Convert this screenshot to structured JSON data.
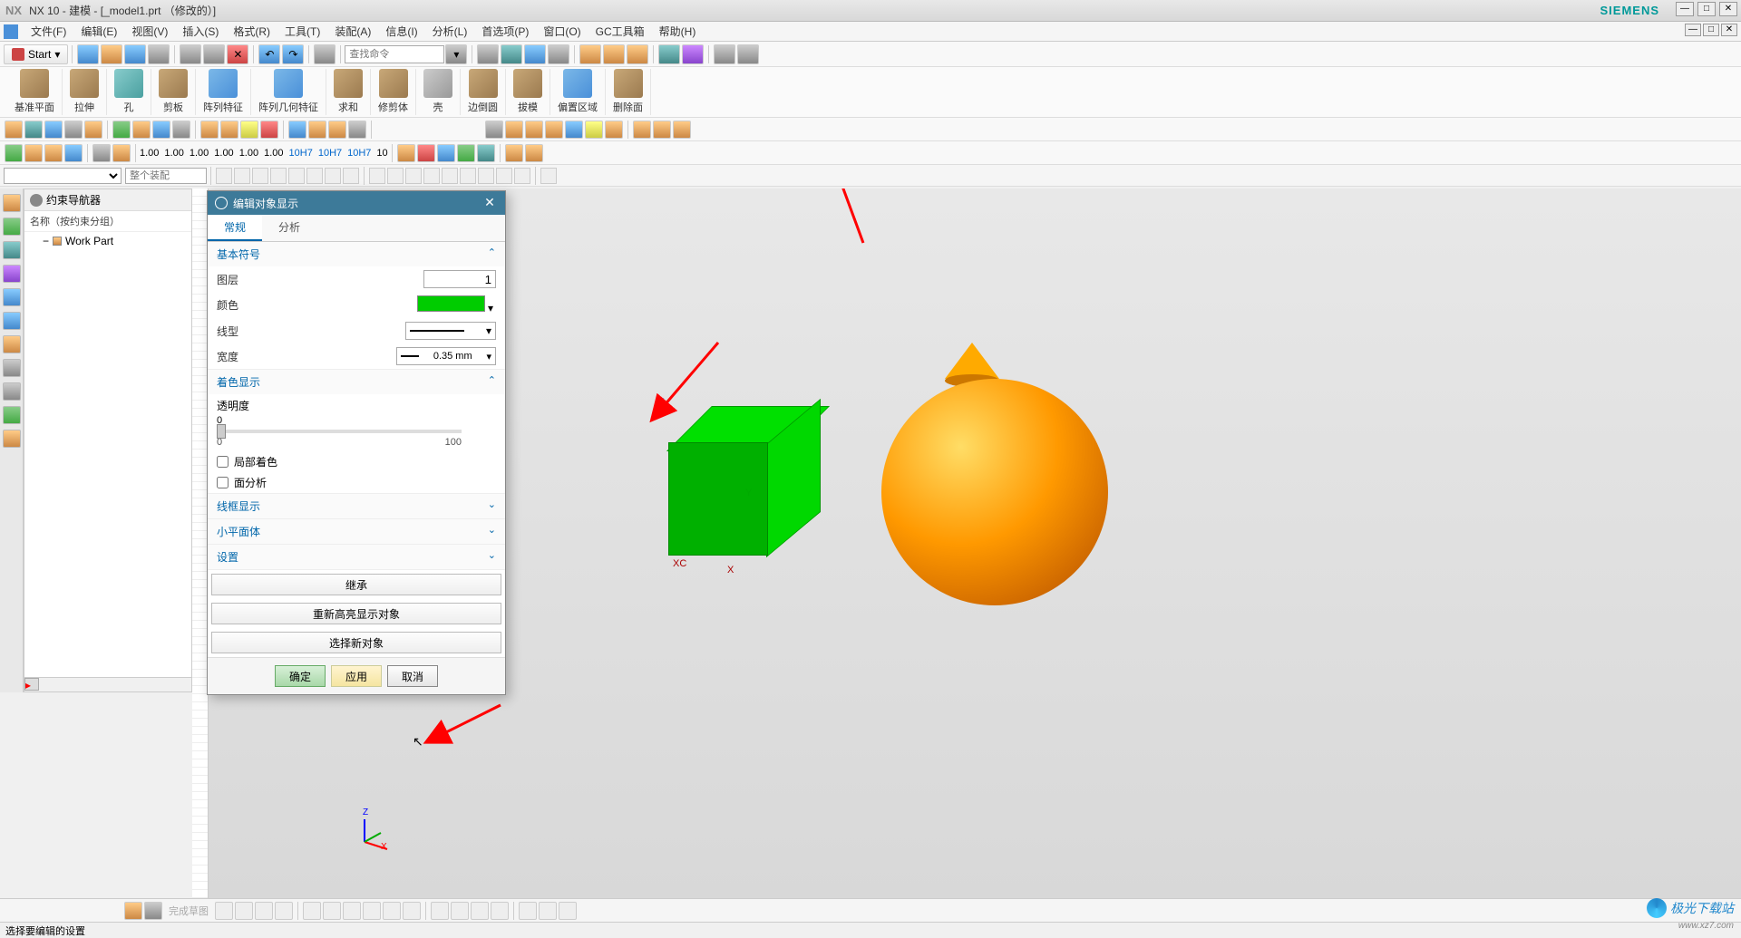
{
  "title": {
    "app": "NX",
    "version": "NX 10 - 建模 - [_model1.prt （修改的）]",
    "brand": "SIEMENS"
  },
  "menu": {
    "items": [
      "文件(F)",
      "编辑(E)",
      "视图(V)",
      "插入(S)",
      "格式(R)",
      "工具(T)",
      "装配(A)",
      "信息(I)",
      "分析(L)",
      "首选项(P)",
      "窗口(O)",
      "GC工具箱",
      "帮助(H)"
    ]
  },
  "toolbar_main": {
    "start": "Start",
    "search_placeholder": "查找命令"
  },
  "ribbon": {
    "groups": [
      {
        "label": "基准平面"
      },
      {
        "label": "拉伸"
      },
      {
        "label": "孔"
      },
      {
        "label": "剪板"
      },
      {
        "label": "阵列特征"
      },
      {
        "label": "阵列几何特征"
      },
      {
        "label": "求和"
      },
      {
        "label": "修剪体"
      },
      {
        "label": "壳"
      },
      {
        "label": "边倒圆"
      },
      {
        "label": "拔模"
      },
      {
        "label": "偏置区域"
      },
      {
        "label": "删除面"
      }
    ]
  },
  "tb3_labels": [
    "1.00",
    "1.00",
    "1.00",
    "1.00",
    "1.00",
    "1.00",
    "10H7",
    "10H7",
    "10H7",
    "10"
  ],
  "selector_placeholder": "整个装配",
  "tree": {
    "title": "约束导航器",
    "col": "名称（按约束分组）",
    "root": "Work Part"
  },
  "dialog": {
    "title": "编辑对象显示",
    "tabs": {
      "general": "常规",
      "analysis": "分析"
    },
    "sections": {
      "basic": "基本符号",
      "shading": "着色显示",
      "wireframe": "线框显示",
      "facet": "小平面体",
      "settings": "设置"
    },
    "labels": {
      "layer": "图层",
      "color": "颜色",
      "linetype": "线型",
      "width": "宽度",
      "transparency": "透明度",
      "partial_shade": "局部着色",
      "face_analysis": "面分析"
    },
    "values": {
      "layer": "1",
      "width": "0.35 mm",
      "slider_min": "0",
      "slider_max": "100",
      "color_hex": "#00cc00"
    },
    "buttons": {
      "inherit": "继承",
      "rehighlight": "重新高亮显示对象",
      "select_new": "选择新对象",
      "ok": "确定",
      "apply": "应用",
      "cancel": "取消"
    }
  },
  "viewport": {
    "axes": {
      "z": "Z",
      "y": "Y",
      "x": "X",
      "xc": "XC"
    }
  },
  "status": "选择要编辑的设置",
  "watermark": {
    "name": "极光下载站",
    "url": "www.xz7.com"
  },
  "bottom_label": "完成草图"
}
